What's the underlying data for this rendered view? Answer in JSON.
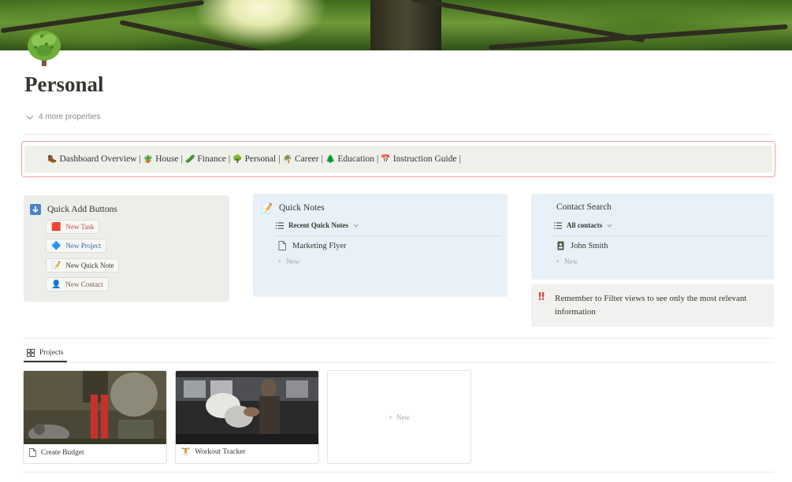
{
  "page": {
    "title": "Personal",
    "properties_toggle": "4 more properties"
  },
  "nav": {
    "items": [
      {
        "icon": "🥾",
        "label": "Dashboard Overview"
      },
      {
        "icon": "🪴",
        "label": "House"
      },
      {
        "icon": "🥒",
        "label": "Finance"
      },
      {
        "icon": "🌳",
        "label": "Personal"
      },
      {
        "icon": "🌴",
        "label": "Career"
      },
      {
        "icon": "🌲",
        "label": "Education"
      },
      {
        "icon": "📅",
        "label": "Instruction Guide"
      }
    ],
    "separator": "|"
  },
  "quick_add": {
    "title": "Quick Add Buttons",
    "buttons": [
      {
        "icon": "🟥",
        "label": "New Task"
      },
      {
        "icon": "🔷",
        "label": "New Project"
      },
      {
        "icon": "📝",
        "label": "New Quick Note"
      },
      {
        "icon": "👤",
        "label": "New Contact"
      }
    ]
  },
  "quick_notes": {
    "title": "Quick Notes",
    "view": "Recent Quick Notes",
    "items": [
      "Marketing Flyer"
    ],
    "new_label": "New"
  },
  "contact_search": {
    "title": "Contact Search",
    "view": "All contacts",
    "items": [
      "John Smith"
    ],
    "new_label": "New"
  },
  "reminder": {
    "icon": "‼",
    "text": "Remember to Filter views to see only the most relevant information"
  },
  "projects": {
    "tab_label": "Projects",
    "cards": [
      {
        "title": "Create Budget",
        "icon": "page-icon"
      },
      {
        "title": "Workout Tracker",
        "icon": "dumbbell-icon"
      }
    ],
    "new_label": "New"
  },
  "colors": {
    "nav_bg": "#edf1ea",
    "nav_border": "#f0a0a4",
    "green_panel": "#ecefe9",
    "blue_panel": "#e7f1f7",
    "gray_panel": "#f1f1ef",
    "alert_red": "#e03e3e"
  }
}
